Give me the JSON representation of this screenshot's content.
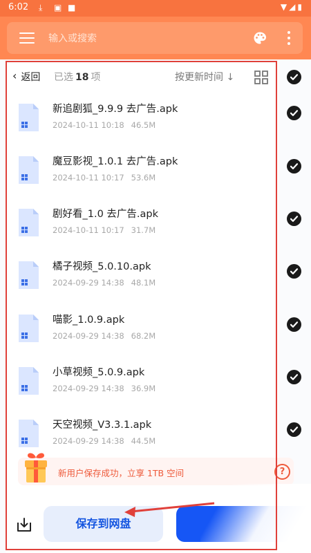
{
  "status_bar": {
    "time": "6:02",
    "notifications": [
      "download-icon",
      "a-badge-icon",
      "square-icon"
    ],
    "right_icons": [
      "wifi-icon",
      "signal-icon",
      "battery-icon"
    ]
  },
  "header": {
    "search_placeholder": "输入或搜索",
    "icons": [
      "menu-icon",
      "palette-icon",
      "more-vertical-icon"
    ]
  },
  "toolbar": {
    "back_label": "返回",
    "selected_prefix": "已选",
    "selected_count": "18",
    "selected_suffix": "项",
    "sort_label": "按更新时间 ↓",
    "view_icon": "grid-icon"
  },
  "files": [
    {
      "name": "新追剧狐_9.9.9 去广告.apk",
      "date": "2024-10-11 10:18",
      "size": "46.5M",
      "checked": true
    },
    {
      "name": "魔豆影视_1.0.1 去广告.apk",
      "date": "2024-10-11 10:17",
      "size": "53.6M",
      "checked": true
    },
    {
      "name": "剧好看_1.0 去广告.apk",
      "date": "2024-10-11 10:17",
      "size": "31.7M",
      "checked": true
    },
    {
      "name": "橘子视频_5.0.10.apk",
      "date": "2024-09-29 14:38",
      "size": "48.1M",
      "checked": true
    },
    {
      "name": "喵影_1.0.9.apk",
      "date": "2024-09-29 14:38",
      "size": "68.2M",
      "checked": true
    },
    {
      "name": "小草视频_5.0.9.apk",
      "date": "2024-09-29 14:38",
      "size": "36.9M",
      "checked": true
    },
    {
      "name": "天空视频_V3.3.1.apk",
      "date": "2024-09-29 14:38",
      "size": "44.5M",
      "checked": true
    }
  ],
  "promo": {
    "text": "新用户保存成功，立享 1TB 空间",
    "help": "?"
  },
  "bottom": {
    "save_label": "保存到网盘"
  },
  "colors": {
    "accent": "#ff8752",
    "primary": "#1656f5",
    "highlight": "#e0403a",
    "promo_text": "#ee5a3b"
  }
}
